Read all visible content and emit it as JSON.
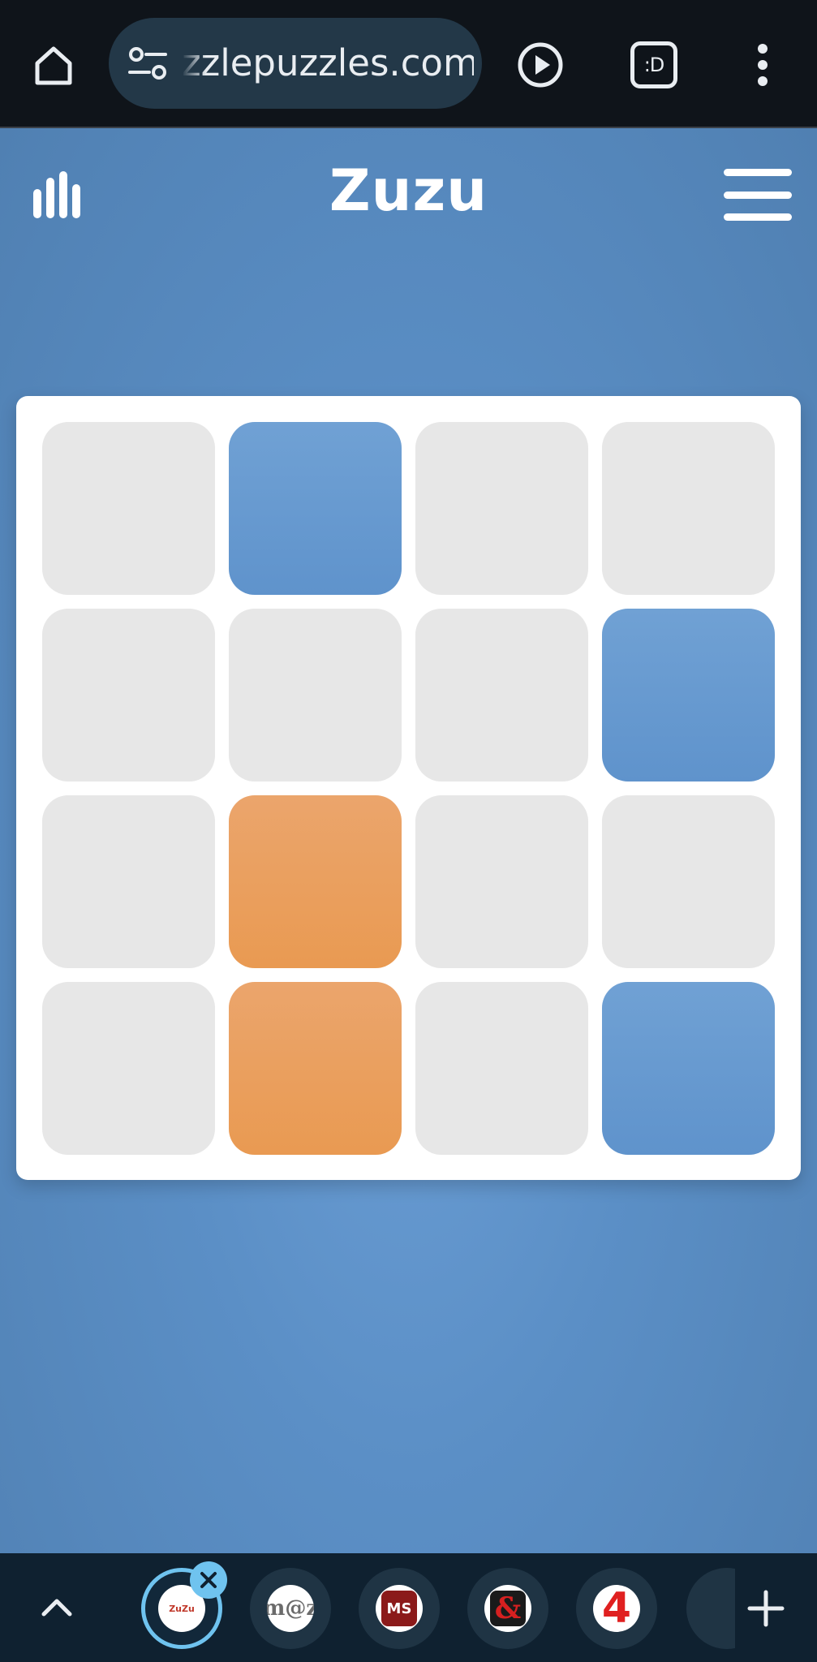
{
  "browser": {
    "url": "zzlepuzzles.com",
    "tabs_icon_text": ":D"
  },
  "header": {
    "title": "Zuzu"
  },
  "board": {
    "rows": [
      [
        "empty",
        "blue",
        "empty",
        "empty"
      ],
      [
        "empty",
        "empty",
        "empty",
        "blue"
      ],
      [
        "empty",
        "orange",
        "empty",
        "empty"
      ],
      [
        "empty",
        "orange",
        "empty",
        "blue"
      ]
    ],
    "colors": {
      "empty": "#e7e7e7",
      "blue": "#6699cf",
      "orange": "#e99f5e"
    }
  },
  "tab_strip": {
    "tabs": [
      {
        "name": "zuzu",
        "favicon_text": "ZuZu",
        "active": true
      },
      {
        "name": "mz",
        "favicon_text": "m@z"
      },
      {
        "name": "ms",
        "favicon_text": "MS"
      },
      {
        "name": "ampersand",
        "favicon_text": "&"
      },
      {
        "name": "four",
        "favicon_text": "4"
      }
    ]
  },
  "icons": {
    "home": "home-icon",
    "tune": "tune-icon",
    "play": "play-circle-icon",
    "tabs": "tab-switcher-icon",
    "more": "more-vert-icon",
    "stats": "bar-chart-icon",
    "menu": "hamburger-menu-icon",
    "up": "chevron-up-icon",
    "close": "close-icon",
    "plus": "plus-icon"
  }
}
